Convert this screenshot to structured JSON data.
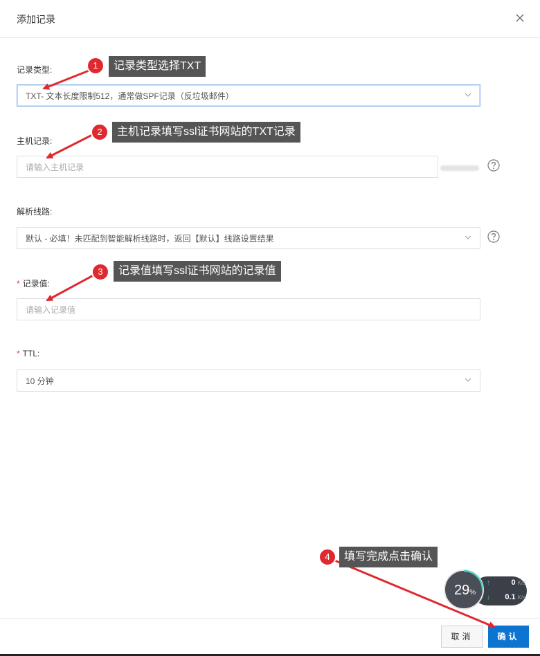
{
  "dialog": {
    "title": "添加记录",
    "close_icon": "close-icon"
  },
  "form": {
    "record_type": {
      "label": "记录类型:",
      "value": "TXT- 文本长度限制512，通常做SPF记录（反垃圾邮件）"
    },
    "host_record": {
      "label": "主机记录:",
      "placeholder": "请输入主机记录"
    },
    "line": {
      "label": "解析线路:",
      "value": "默认 - 必填！未匹配到智能解析线路时，返回【默认】线路设置结果"
    },
    "record_value": {
      "required_mark": "*",
      "label": "记录值:",
      "placeholder": "请输入记录值"
    },
    "ttl": {
      "required_mark": "*",
      "label": "TTL:",
      "value": "10 分钟"
    }
  },
  "annotations": [
    {
      "number": "1",
      "text": "记录类型选择TXT"
    },
    {
      "number": "2",
      "text": "主机记录填写ssl证书网站的TXT记录"
    },
    {
      "number": "3",
      "text": "记录值填写ssl证书网站的记录值"
    },
    {
      "number": "4",
      "text": "填写完成点击确认"
    }
  ],
  "annotation_color": "#e0292f",
  "footer": {
    "cancel_label": "取消",
    "ok_label": "确认"
  },
  "accent_color": "#0d74d0",
  "speed_widget": {
    "percent": "29",
    "percent_unit": "%",
    "upload_value": "0",
    "upload_unit": "K/s",
    "download_value": "0.1",
    "download_unit": "K/s"
  }
}
